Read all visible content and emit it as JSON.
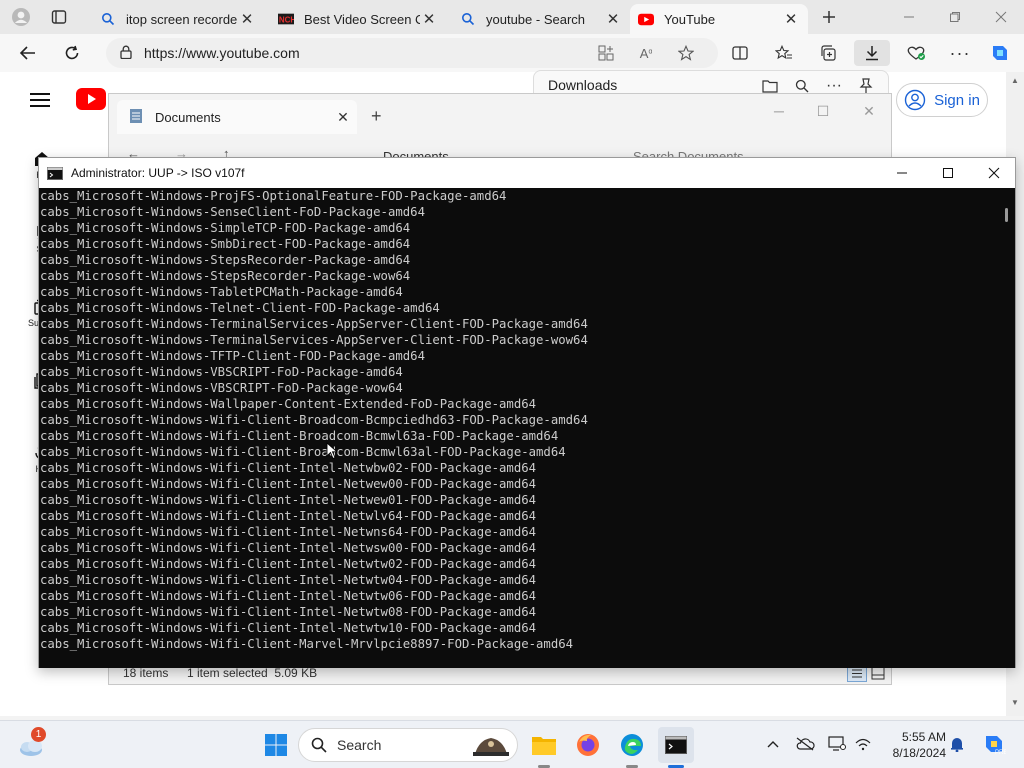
{
  "browser": {
    "tabs": [
      {
        "title": "itop screen recorder -",
        "icon": "search-icon"
      },
      {
        "title": "Best Video Screen Ca",
        "icon": "nch-logo-icon"
      },
      {
        "title": "youtube - Search",
        "icon": "search-icon"
      },
      {
        "title": "YouTube",
        "icon": "youtube-icon",
        "active": true
      }
    ],
    "url": "https://www.youtube.com"
  },
  "youtube": {
    "sidebar": [
      "Ho",
      "Sh",
      "Subscr",
      "Y",
      "His"
    ],
    "signin_label": "Sign in"
  },
  "downloads": {
    "title": "Downloads"
  },
  "explorer": {
    "tab_title": "Documents",
    "breadcrumb": "Documents",
    "search_placeholder": "Search Documents",
    "status_items": "18 items",
    "status_selected": "1 item selected  5.09 KB"
  },
  "cmd": {
    "title": "Administrator:  UUP -> ISO v107f",
    "lines": [
      "cabs_Microsoft-Windows-ProjFS-OptionalFeature-FOD-Package-amd64",
      "cabs_Microsoft-Windows-SenseClient-FoD-Package-amd64",
      "cabs_Microsoft-Windows-SimpleTCP-FOD-Package-amd64",
      "cabs_Microsoft-Windows-SmbDirect-FOD-Package-amd64",
      "cabs_Microsoft-Windows-StepsRecorder-Package-amd64",
      "cabs_Microsoft-Windows-StepsRecorder-Package-wow64",
      "cabs_Microsoft-Windows-TabletPCMath-Package-amd64",
      "cabs_Microsoft-Windows-Telnet-Client-FOD-Package-amd64",
      "cabs_Microsoft-Windows-TerminalServices-AppServer-Client-FOD-Package-amd64",
      "cabs_Microsoft-Windows-TerminalServices-AppServer-Client-FOD-Package-wow64",
      "cabs_Microsoft-Windows-TFTP-Client-FOD-Package-amd64",
      "cabs_Microsoft-Windows-VBSCRIPT-FoD-Package-amd64",
      "cabs_Microsoft-Windows-VBSCRIPT-FoD-Package-wow64",
      "cabs_Microsoft-Windows-Wallpaper-Content-Extended-FoD-Package-amd64",
      "cabs_Microsoft-Windows-Wifi-Client-Broadcom-Bcmpciedhd63-FOD-Package-amd64",
      "cabs_Microsoft-Windows-Wifi-Client-Broadcom-Bcmwl63a-FOD-Package-amd64",
      "cabs_Microsoft-Windows-Wifi-Client-Broadcom-Bcmwl63al-FOD-Package-amd64",
      "cabs_Microsoft-Windows-Wifi-Client-Intel-Netwbw02-FOD-Package-amd64",
      "cabs_Microsoft-Windows-Wifi-Client-Intel-Netwew00-FOD-Package-amd64",
      "cabs_Microsoft-Windows-Wifi-Client-Intel-Netwew01-FOD-Package-amd64",
      "cabs_Microsoft-Windows-Wifi-Client-Intel-Netwlv64-FOD-Package-amd64",
      "cabs_Microsoft-Windows-Wifi-Client-Intel-Netwns64-FOD-Package-amd64",
      "cabs_Microsoft-Windows-Wifi-Client-Intel-Netwsw00-FOD-Package-amd64",
      "cabs_Microsoft-Windows-Wifi-Client-Intel-Netwtw02-FOD-Package-amd64",
      "cabs_Microsoft-Windows-Wifi-Client-Intel-Netwtw04-FOD-Package-amd64",
      "cabs_Microsoft-Windows-Wifi-Client-Intel-Netwtw06-FOD-Package-amd64",
      "cabs_Microsoft-Windows-Wifi-Client-Intel-Netwtw08-FOD-Package-amd64",
      "cabs_Microsoft-Windows-Wifi-Client-Intel-Netwtw10-FOD-Package-amd64",
      "cabs_Microsoft-Windows-Wifi-Client-Marvel-Mrvlpcie8897-FOD-Package-amd64"
    ]
  },
  "taskbar": {
    "search_label": "Search",
    "weather_badge": "1",
    "time": "5:55 AM",
    "date": "8/18/2024"
  },
  "colors": {
    "youtube_red": "#ff0000",
    "cmd_bg": "#0c0c0c",
    "cmd_text": "#cccccc",
    "signin_blue": "#1a62d6",
    "copilot_accent": "#2a7cf6"
  }
}
